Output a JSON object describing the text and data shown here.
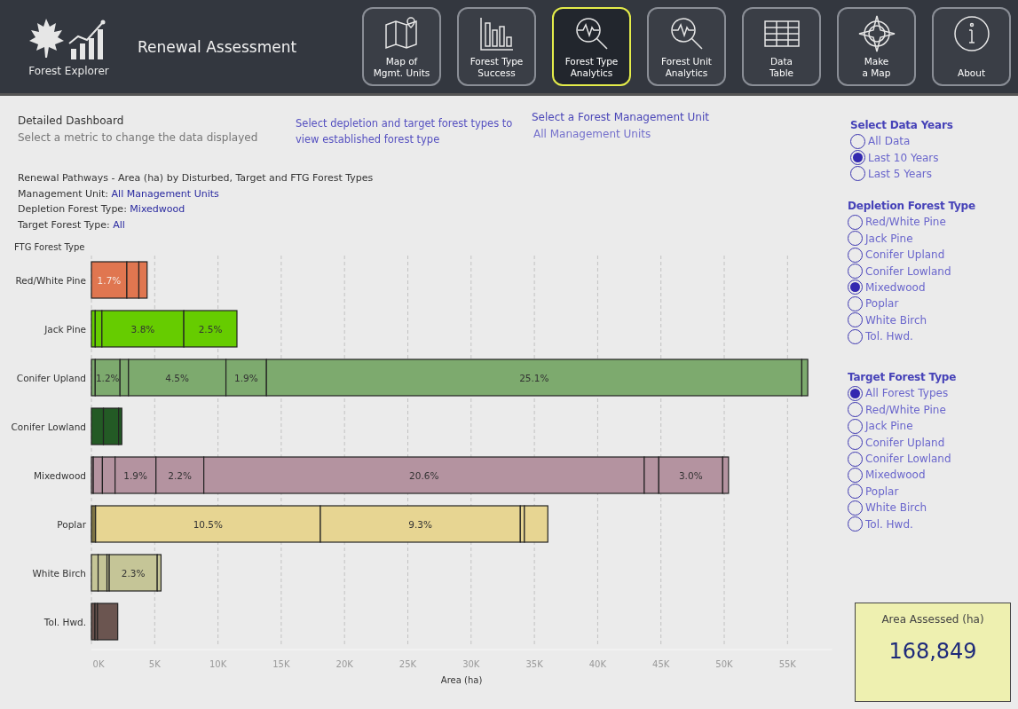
{
  "header": {
    "logo_caption": "Forest Explorer",
    "title": "Renewal Assessment",
    "nav": [
      {
        "kind": "map",
        "label": "Map of\nMgmt. Units",
        "selected": false
      },
      {
        "kind": "bars",
        "label": "Forest Type\nSuccess",
        "selected": false
      },
      {
        "kind": "pulse",
        "label": "Forest Type\nAnalytics",
        "selected": true
      },
      {
        "kind": "pulse",
        "label": "Forest Unit\nAnalytics",
        "selected": false
      },
      {
        "kind": "table",
        "label": "Data\nTable",
        "selected": false
      },
      {
        "kind": "compass",
        "label": "Make\na Map",
        "selected": false
      },
      {
        "kind": "info",
        "label": "About",
        "selected": false
      }
    ]
  },
  "intro": {
    "title": "Detailed Dashboard",
    "subtitle": "Select a metric to change the data displayed",
    "hint": "Select depletion and target forest types to view established forest type"
  },
  "unit_filter": {
    "title": "Select a Forest Management Unit",
    "value": "All Management Units"
  },
  "chart_info": {
    "title": "Renewal Pathways - Area (ha) by Disturbed, Target and FTG Forest Types",
    "lines": [
      {
        "label": "Management Unit:",
        "value": "All Management Units"
      },
      {
        "label": "Depletion Forest Type:",
        "value": "Mixedwood"
      },
      {
        "label": "Target Forest Type:",
        "value": "All"
      }
    ]
  },
  "chart": {
    "chart_data": {
      "type": "bar",
      "orientation": "horizontal",
      "stacked": true,
      "ylabel": "FTG Forest Type",
      "xlabel": "Area (ha)",
      "categories": [
        "Red/White Pine",
        "Jack Pine",
        "Conifer Upland",
        "Conifer Lowland",
        "Mixedwood",
        "Poplar",
        "White Birch",
        "Tol. Hwd."
      ],
      "grid": true,
      "series": [
        {
          "values": [
            2800,
            300,
            300,
            950,
            150,
            330,
            530,
            280
          ],
          "colors": [
            "#e07650",
            "#66cc00",
            "#7daa6e",
            "#235a25",
            "#b493a0",
            "#7d7345",
            "#c5c597",
            "#6b5550"
          ]
        },
        {
          "values": [
            950,
            530,
            1960,
            1200,
            720,
            17760,
            700,
            200
          ],
          "colors": [
            "#e07650",
            "#66cc00",
            "#7daa6e",
            "#235a25",
            "#b493a0",
            "#e7d592",
            "#c5c597",
            "#6b5550"
          ]
        },
        {
          "values": [
            650,
            6470,
            670,
            250,
            1000,
            15800,
            180,
            1600
          ],
          "colors": [
            "#e07650",
            "#66cc00",
            "#7daa6e",
            "#235a25",
            "#b493a0",
            "#e7d592",
            "#c5c597",
            "#6b5550"
          ]
        },
        {
          "values": [
            null,
            4200,
            7700,
            null,
            3230,
            320,
            3790,
            null
          ],
          "colors": [
            null,
            "#66cc00",
            "#7daa6e",
            null,
            "#b493a0",
            "#e7d592",
            "#c5c597",
            null
          ]
        },
        {
          "values": [
            null,
            null,
            3200,
            null,
            3780,
            1850,
            300,
            null
          ],
          "colors": [
            null,
            null,
            "#7daa6e",
            null,
            "#b493a0",
            "#e7d592",
            "#c5c597",
            null
          ]
        },
        {
          "values": [
            null,
            null,
            42300,
            null,
            34800,
            null,
            null,
            null
          ],
          "colors": [
            null,
            null,
            "#7daa6e",
            null,
            "#b493a0",
            null,
            null,
            null
          ]
        },
        {
          "values": [
            null,
            null,
            470,
            null,
            1150,
            null,
            null,
            null
          ],
          "colors": [
            null,
            null,
            "#7daa6e",
            null,
            "#b493a0",
            null,
            null,
            null
          ]
        },
        {
          "values": [
            null,
            null,
            null,
            null,
            5050,
            null,
            null,
            null
          ],
          "colors": [
            null,
            null,
            null,
            null,
            "#b493a0",
            null,
            null,
            null
          ]
        },
        {
          "values": [
            null,
            null,
            null,
            null,
            460,
            null,
            null,
            null
          ],
          "colors": [
            null,
            null,
            null,
            null,
            "#b493a0",
            null,
            null,
            null
          ]
        }
      ],
      "value_labels": [
        [
          "1.7%",
          null,
          null,
          null,
          null,
          null,
          null,
          null
        ],
        [
          null,
          null,
          "1.2%",
          null,
          null,
          "10.5%",
          null,
          null
        ],
        [
          null,
          "3.8%",
          null,
          null,
          null,
          "9.3%",
          null,
          null
        ],
        [
          null,
          "2.5%",
          "4.5%",
          null,
          "1.9%",
          null,
          "2.3%",
          null
        ],
        [
          null,
          null,
          "1.9%",
          null,
          "2.2%",
          null,
          null,
          null
        ],
        [
          null,
          null,
          "25.1%",
          null,
          "20.6%",
          null,
          null,
          null
        ],
        [
          null,
          null,
          null,
          null,
          null,
          null,
          null,
          null
        ],
        [
          null,
          null,
          null,
          null,
          "3.0%",
          null,
          null,
          null
        ],
        [
          null,
          null,
          null,
          null,
          null,
          null,
          null,
          null
        ]
      ],
      "xlim": [
        0,
        58500
      ],
      "xticks": [
        {
          "value": 0,
          "label": "0K"
        },
        {
          "value": 5000,
          "label": "5K"
        },
        {
          "value": 10000,
          "label": "10K"
        },
        {
          "value": 15000,
          "label": "15K"
        },
        {
          "value": 20000,
          "label": "20K"
        },
        {
          "value": 25000,
          "label": "25K"
        },
        {
          "value": 30000,
          "label": "30K"
        },
        {
          "value": 35000,
          "label": "35K"
        },
        {
          "value": 40000,
          "label": "40K"
        },
        {
          "value": 45000,
          "label": "45K"
        },
        {
          "value": 50000,
          "label": "50K"
        },
        {
          "value": 55000,
          "label": "55K"
        }
      ]
    }
  },
  "filters": [
    {
      "title": "Select Data Years",
      "options": [
        {
          "label": "All Data",
          "selected": false
        },
        {
          "label": "Last 10 Years",
          "selected": true
        },
        {
          "label": "Last 5 Years",
          "selected": false
        }
      ]
    },
    {
      "title": "Depletion Forest Type",
      "options": [
        {
          "label": "Red/White Pine",
          "selected": false
        },
        {
          "label": "Jack Pine",
          "selected": false
        },
        {
          "label": "Conifer Upland",
          "selected": false
        },
        {
          "label": "Conifer Lowland",
          "selected": false
        },
        {
          "label": "Mixedwood",
          "selected": true
        },
        {
          "label": "Poplar",
          "selected": false
        },
        {
          "label": "White Birch",
          "selected": false
        },
        {
          "label": "Tol. Hwd.",
          "selected": false
        }
      ]
    },
    {
      "title": "Target Forest Type",
      "options": [
        {
          "label": "All Forest Types",
          "selected": true
        },
        {
          "label": "Red/White Pine",
          "selected": false
        },
        {
          "label": "Jack Pine",
          "selected": false
        },
        {
          "label": "Conifer Upland",
          "selected": false
        },
        {
          "label": "Conifer Lowland",
          "selected": false
        },
        {
          "label": "Mixedwood",
          "selected": false
        },
        {
          "label": "Poplar",
          "selected": false
        },
        {
          "label": "White Birch",
          "selected": false
        },
        {
          "label": "Tol. Hwd.",
          "selected": false
        }
      ]
    }
  ],
  "summary": {
    "label": "Area Assessed (ha)",
    "value": "168,849"
  }
}
